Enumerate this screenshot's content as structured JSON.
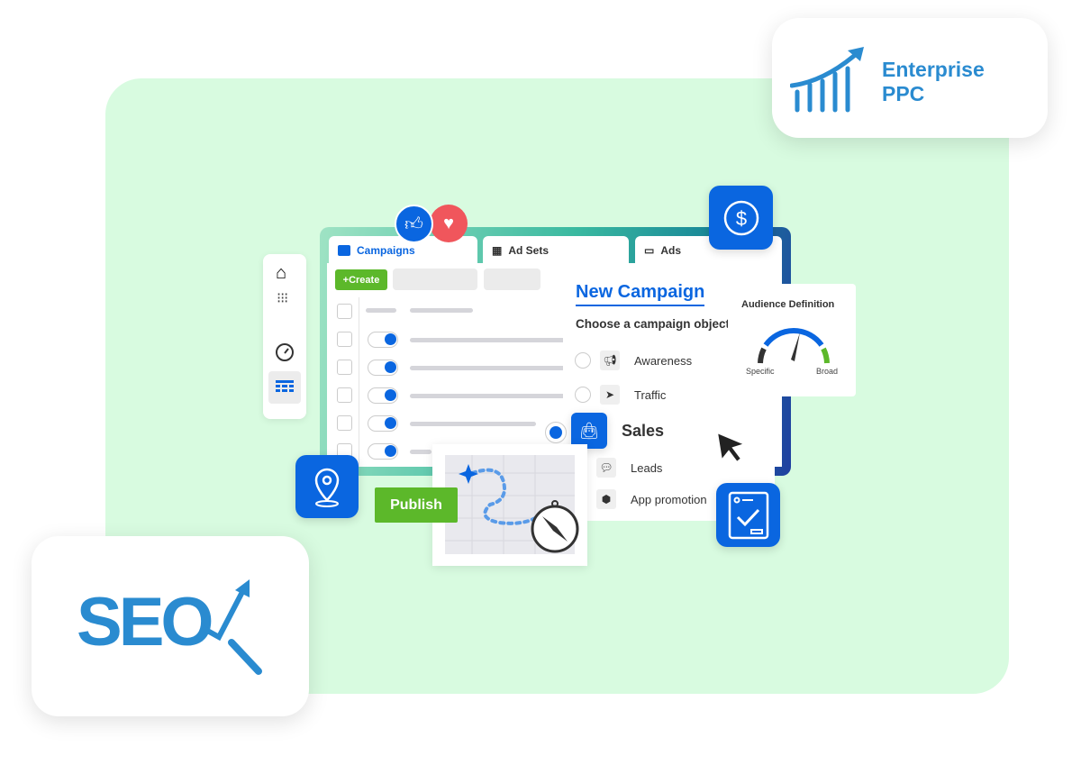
{
  "brand": {
    "ppc_title": "Enterprise",
    "ppc_subtitle": "PPC",
    "seo_logo": "SEO",
    "color": "#2a8bd0"
  },
  "tabs": [
    {
      "label": "Campaigns",
      "icon": "folder-icon",
      "active": true
    },
    {
      "label": "Ad Sets",
      "icon": "grid-icon"
    },
    {
      "label": "Ads",
      "icon": "window-icon"
    }
  ],
  "toolbar": {
    "create_label": "+Create"
  },
  "sidebar": {
    "items": [
      {
        "icon": "home-icon"
      },
      {
        "icon": "apps-icon"
      },
      {
        "icon": "gauge-icon"
      },
      {
        "icon": "table-icon",
        "active": true
      }
    ]
  },
  "rows": 5,
  "new_campaign": {
    "title": "New Campaign",
    "prompt": "Choose a campaign objecti",
    "options": [
      {
        "label": "Awareness",
        "icon": "megaphone-icon"
      },
      {
        "label": "Traffic",
        "icon": "cursor-icon"
      },
      {
        "label": "Sales",
        "icon": "shopping-bag-icon",
        "selected": true
      },
      {
        "label": "Leads",
        "icon": "chat-icon"
      },
      {
        "label": "App promotion",
        "icon": "box-icon"
      }
    ]
  },
  "audience": {
    "title": "Audience Definition",
    "min_label": "Specific",
    "max_label": "Broad"
  },
  "publish_label": "Publish",
  "colors": {
    "accent": "#0a66e0",
    "green": "#5cb82a",
    "heart": "#f0565c",
    "background": "#d8fbe0"
  }
}
